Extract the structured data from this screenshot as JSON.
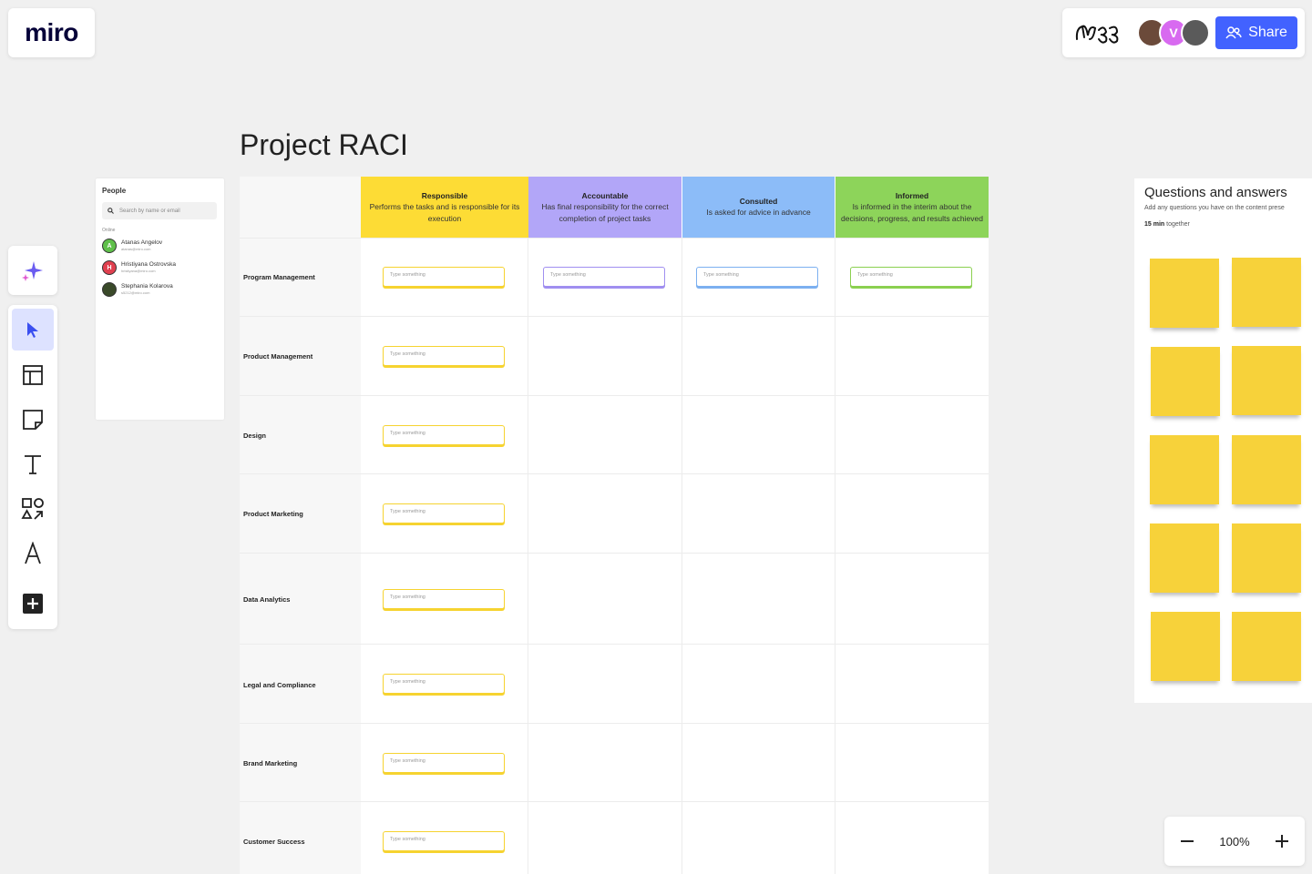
{
  "app": {
    "logo_text": "miro"
  },
  "topbar": {
    "avatars": [
      {
        "name": "user-avatar-1",
        "initial": "",
        "color": "#6b4a3a"
      },
      {
        "name": "user-avatar-v",
        "initial": "V",
        "color": "#d86af0"
      },
      {
        "name": "user-avatar-3",
        "initial": "",
        "color": "#5a5a5a"
      }
    ],
    "share_label": "Share"
  },
  "board": {
    "title": "Project RACI"
  },
  "people_panel": {
    "title": "People",
    "search_placeholder": "Search by name or email",
    "online_label": "Online",
    "people": [
      {
        "initial": "A",
        "name": "Atanas Angelov",
        "email": "atanas@miro.com",
        "color": "#5fc04a"
      },
      {
        "initial": "H",
        "name": "Hristiyana Ostrovska",
        "email": "hristiyana@miro.com",
        "color": "#e0404f"
      },
      {
        "initial": "",
        "name": "Stephania Kolarova",
        "email": "s5212@miro.com",
        "color": "#3a4a2a"
      }
    ]
  },
  "raci": {
    "columns": [
      {
        "title": "Responsible",
        "desc": "Performs the tasks and is responsible for its execution",
        "color": "#fddc35"
      },
      {
        "title": "Accountable",
        "desc": "Has final responsibility for the correct completion of project tasks",
        "color": "#b2a6f8"
      },
      {
        "title": "Consulted",
        "desc": "Is asked for advice in advance",
        "color": "#8cbcf8"
      },
      {
        "title": "Informed",
        "desc": "Is informed in the interim about the decisions, progress, and results achieved",
        "color": "#8dd45a"
      }
    ],
    "rows": [
      "Program Management",
      "Product Management",
      "Design",
      "Product Marketing",
      "Data Analytics",
      "Legal and Compliance",
      "Brand Marketing",
      "Customer Success"
    ],
    "input_placeholder": "Type something"
  },
  "qa_panel": {
    "title": "Questions and answers",
    "subtitle": "Add any questions you have on the content prese",
    "time_bold": "15 min",
    "time_rest": " together",
    "sticky_color": "#f7d23a"
  },
  "zoom": {
    "value": "100%"
  }
}
